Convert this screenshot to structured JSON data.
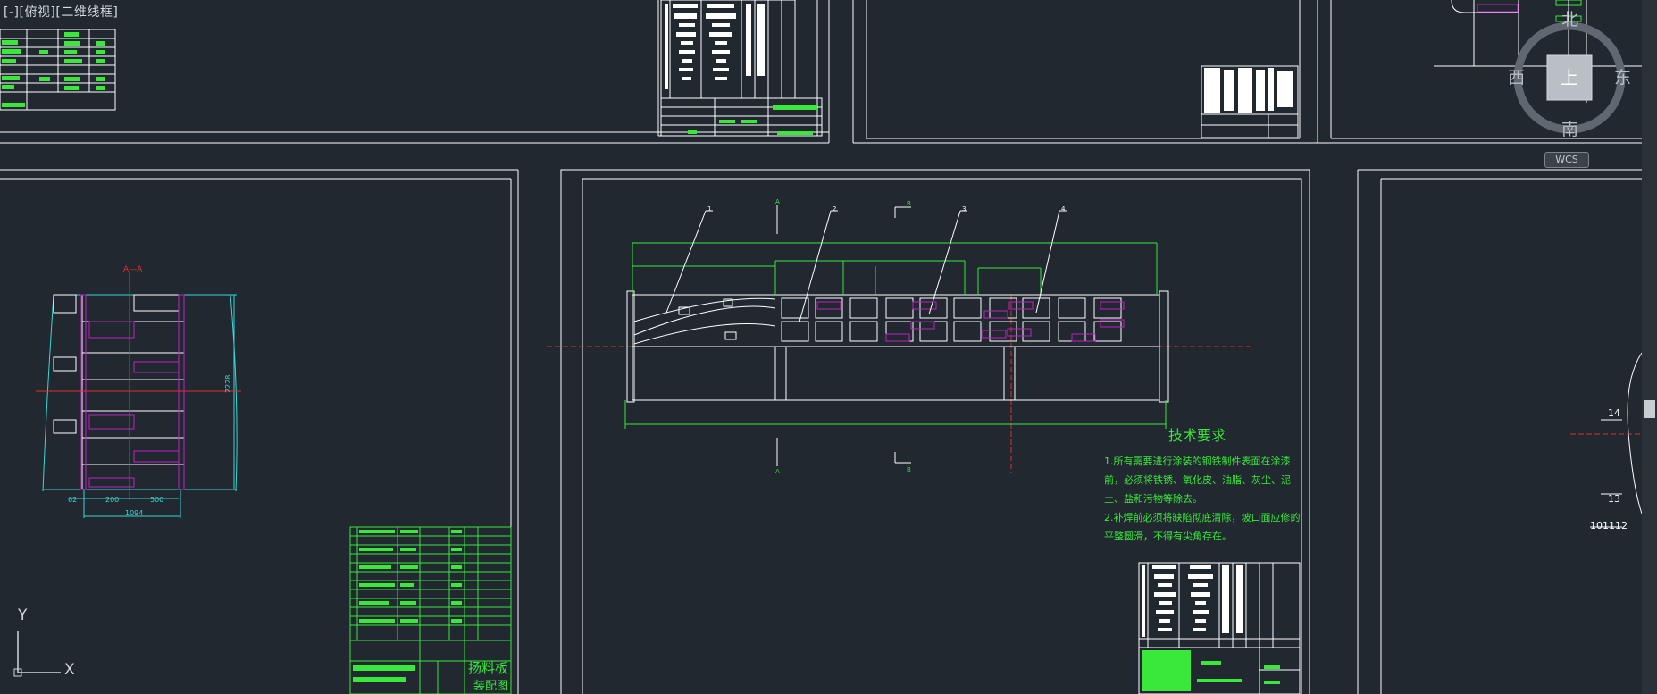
{
  "viewport": {
    "label": "[-][俯视][二维线框]"
  },
  "viewcube": {
    "north": "北",
    "south": "南",
    "east": "东",
    "west": "西",
    "face": "上",
    "wcs": "WCS"
  },
  "ucs": {
    "x_label": "X",
    "y_label": "Y"
  },
  "colors": {
    "background": "#212830",
    "frame": "#ffffff",
    "green": "#39e83a",
    "magenta": "#c020c8",
    "red": "#e0312e",
    "cyan": "#3bd6d6"
  },
  "main_drawing": {
    "tech_title": "技术要求",
    "tech_lines": [
      "1.所有需要进行涂装的钢铁制件表面在涂漆",
      "前，必须将铁锈、氧化皮、油脂、灰尘、泥",
      "土、盐和污物等除去。",
      "2.补焊前必须将缺陷彻底清除，坡口面应修的",
      "平整圆滑，不得有尖角存在。"
    ],
    "section_A": "A",
    "section_B": "B",
    "balloons": [
      "1",
      "2",
      "3",
      "4"
    ]
  },
  "left_drawing": {
    "section_label": "A—A",
    "title_block_name": "扬料板",
    "title_block_sub": "装配图",
    "dim_2228": "2228",
    "dim_200": "200",
    "dim_500": "500",
    "dim_1094": "1094",
    "dim_62": "62"
  },
  "right_drawing": {
    "labels": [
      "14",
      "13",
      "101112"
    ]
  }
}
